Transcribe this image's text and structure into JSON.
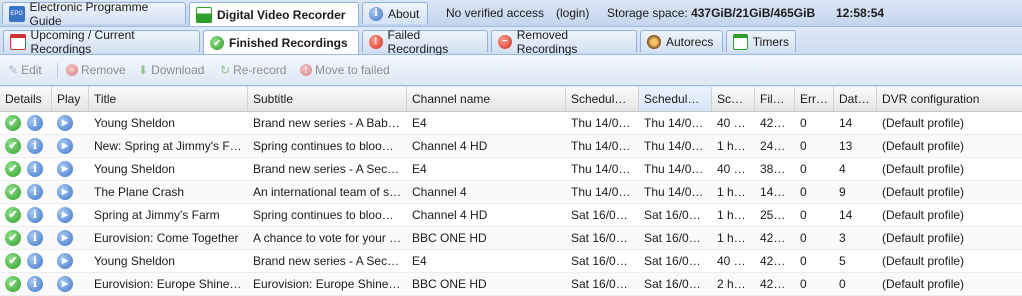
{
  "top_tabs": {
    "epg": "Electronic Programme Guide",
    "dvr": "Digital Video Recorder",
    "about": "About"
  },
  "status": {
    "access": "No verified access",
    "login": "(login)",
    "storage_label": "Storage space:",
    "storage_value": "437GiB/21GiB/465GiB",
    "clock": "12:58:54"
  },
  "sub_tabs": {
    "upcoming": "Upcoming / Current Recordings",
    "finished": "Finished Recordings",
    "failed": "Failed Recordings",
    "removed": "Removed Recordings",
    "autorecs": "Autorecs",
    "timers": "Timers"
  },
  "toolbar": {
    "edit": "Edit",
    "remove": "Remove",
    "download": "Download",
    "rerecord": "Re-record",
    "move_failed": "Move to failed"
  },
  "columns": {
    "details": "Details",
    "play": "Play",
    "title": "Title",
    "subtitle": "Subtitle",
    "channel": "Channel name",
    "sched_start": "Schedule…",
    "sched_stop": "Schedule…",
    "sc": "Sc…",
    "file": "File…",
    "err": "Err…",
    "dat": "Dat…",
    "dvr_config": "DVR configuration"
  },
  "rows": [
    {
      "title": "Young Sheldon",
      "subtitle": "Brand new series - A Bab…",
      "channel": "E4",
      "start": "Thu 14/0…",
      "stop": "Thu 14/0…",
      "sc": "40 …",
      "file": "42…",
      "err": "0",
      "dat": "14",
      "cfg": "(Default profile)"
    },
    {
      "title": "New: Spring at Jimmy's F…",
      "subtitle": "Spring continues to bloom…",
      "channel": "Channel 4 HD",
      "start": "Thu 14/0…",
      "stop": "Thu 14/0…",
      "sc": "1 h…",
      "file": "24…",
      "err": "0",
      "dat": "13",
      "cfg": "(Default profile)"
    },
    {
      "title": "Young Sheldon",
      "subtitle": "Brand new series - A Secr…",
      "channel": "E4",
      "start": "Thu 14/0…",
      "stop": "Thu 14/0…",
      "sc": "40 …",
      "file": "38…",
      "err": "0",
      "dat": "4",
      "cfg": "(Default profile)"
    },
    {
      "title": "The Plane Crash",
      "subtitle": "An international team of s…",
      "channel": "Channel 4",
      "start": "Thu 14/0…",
      "stop": "Thu 14/0…",
      "sc": "1 h…",
      "file": "14…",
      "err": "0",
      "dat": "9",
      "cfg": "(Default profile)"
    },
    {
      "title": "Spring at Jimmy's Farm",
      "subtitle": "Spring continues to bloom…",
      "channel": "Channel 4 HD",
      "start": "Sat 16/05…",
      "stop": "Sat 16/05…",
      "sc": "1 h…",
      "file": "25…",
      "err": "0",
      "dat": "14",
      "cfg": "(Default profile)"
    },
    {
      "title": "Eurovision: Come Together",
      "subtitle": "A chance to vote for your …",
      "channel": "BBC ONE HD",
      "start": "Sat 16/05…",
      "stop": "Sat 16/05…",
      "sc": "1 h…",
      "file": "42…",
      "err": "0",
      "dat": "3",
      "cfg": "(Default profile)"
    },
    {
      "title": "Young Sheldon",
      "subtitle": "Brand new series - A Secr…",
      "channel": "E4",
      "start": "Sat 16/05…",
      "stop": "Sat 16/05…",
      "sc": "40 …",
      "file": "42…",
      "err": "0",
      "dat": "5",
      "cfg": "(Default profile)"
    },
    {
      "title": "Eurovision: Europe Shine …",
      "subtitle": "Eurovision: Europe Shine …",
      "channel": "BBC ONE HD",
      "start": "Sat 16/05…",
      "stop": "Sat 16/05…",
      "sc": "2 h…",
      "file": "42…",
      "err": "0",
      "dat": "0",
      "cfg": "(Default profile)"
    }
  ],
  "icons": {
    "details_ok": "check-circle-icon",
    "details_info": "info-icon",
    "play": "play-icon"
  },
  "colors": {
    "header_bg": "#c3d5ed",
    "accent_blue": "#3b74c9",
    "ok_green": "#2e9e2a",
    "failed_red": "#d0301f"
  }
}
